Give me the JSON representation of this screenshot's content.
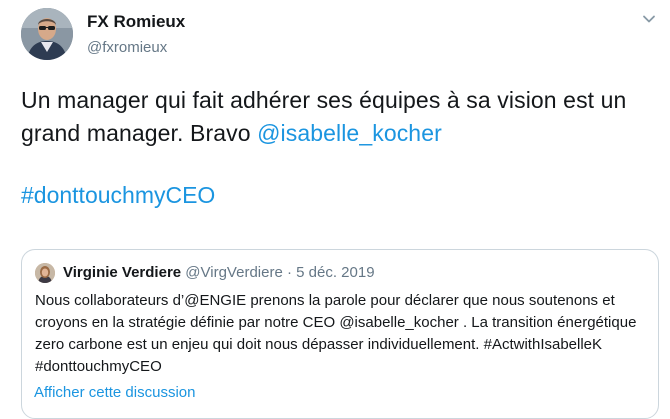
{
  "author": {
    "name": "FX Romieux",
    "handle": "@fxromieux"
  },
  "tweet": {
    "text_part1": "Un manager qui fait adhérer ses équipes à sa vision est un grand manager. Bravo ",
    "mention": "@isabelle_kocher",
    "hashtag": "#donttouchmyCEO"
  },
  "quoted": {
    "name": "Virginie Verdiere",
    "handle": "@VirgVerdiere",
    "separator": " · ",
    "date": "5 déc. 2019",
    "body": "Nous collaborateurs d’@ENGIE prenons la parole pour déclarer que nous soutenons et croyons en la stratégie définie par notre CEO @isabelle_kocher . La transition énergétique zero carbone est un enjeu qui doit nous dépasser individuellement. #ActwithIsabelleK #donttouchmyCEO",
    "show_thread": "Afficher cette discussion"
  },
  "colors": {
    "link": "#1b95e0",
    "secondary_text": "#657786",
    "border": "#ccd6dd"
  },
  "icons": {
    "menu": "chevron-down-icon"
  }
}
